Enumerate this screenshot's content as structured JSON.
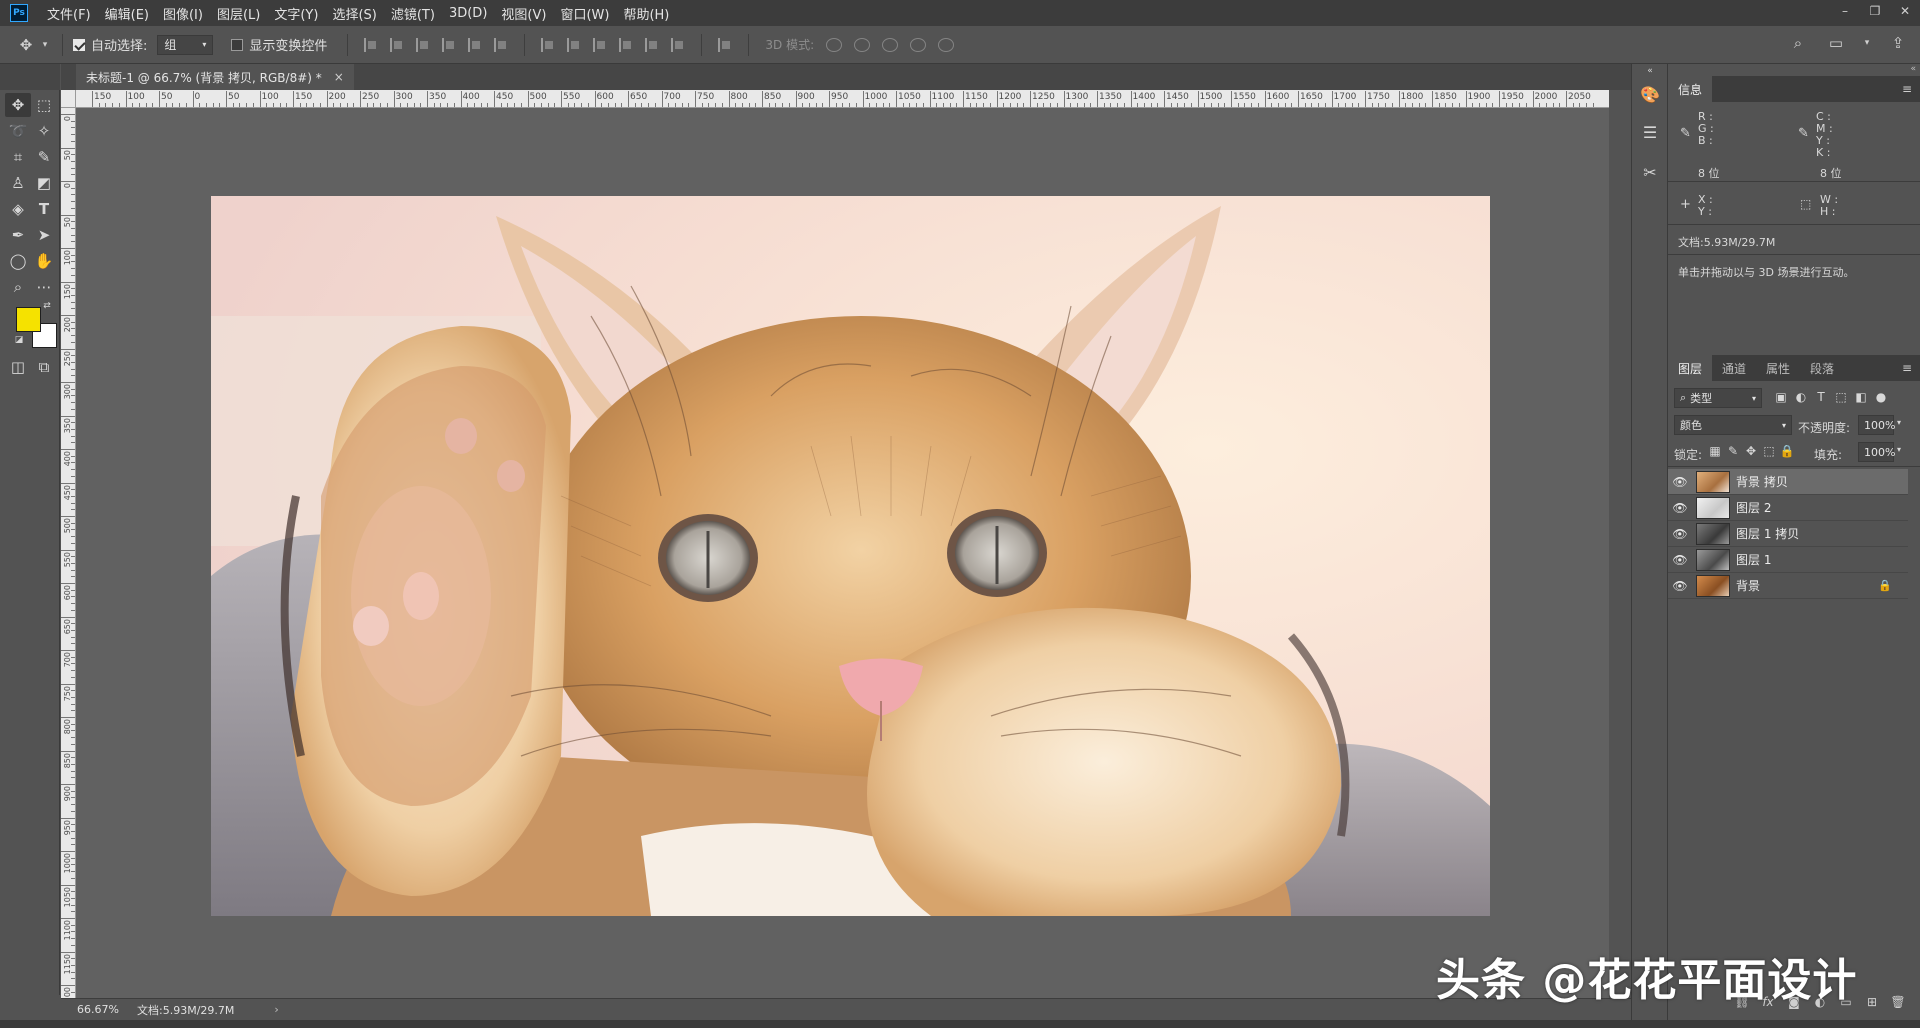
{
  "app": {
    "logo": "Ps"
  },
  "menu": [
    "文件(F)",
    "编辑(E)",
    "图像(I)",
    "图层(L)",
    "文字(Y)",
    "选择(S)",
    "滤镜(T)",
    "3D(D)",
    "视图(V)",
    "窗口(W)",
    "帮助(H)"
  ],
  "options": {
    "auto_select_label": "自动选择:",
    "auto_select_checked": true,
    "auto_select_value": "组",
    "show_transform_label": "显示变换控件",
    "show_transform_checked": false,
    "mode_3d_label": "3D 模式:"
  },
  "document": {
    "tab_title": "未标题-1 @ 66.7% (背景 拷贝, RGB/8#) *",
    "close": "×",
    "zoom": "66.67%",
    "doc_size": "文档:5.93M/29.7M"
  },
  "rulers": {
    "top_labels": [
      "150",
      "100",
      "50",
      "0",
      "50",
      "100",
      "150",
      "200",
      "250",
      "300",
      "350",
      "400",
      "450",
      "500",
      "550",
      "600",
      "650",
      "700",
      "750",
      "800",
      "850",
      "900",
      "950",
      "1000",
      "1050",
      "1100",
      "1150",
      "1200",
      "1250",
      "1300",
      "1350",
      "1400",
      "1450",
      "1500",
      "1550",
      "1600",
      "1650",
      "1700",
      "1750",
      "1800",
      "1850",
      "1900",
      "1950",
      "2000",
      "2050"
    ],
    "left_labels": [
      "0",
      "50",
      "0",
      "50",
      "100",
      "150",
      "200",
      "250",
      "300",
      "350",
      "400",
      "450",
      "500",
      "550",
      "600",
      "650",
      "700",
      "750",
      "800",
      "850",
      "900",
      "950",
      "1000",
      "1050",
      "1100",
      "1150",
      "1200"
    ]
  },
  "colors": {
    "foreground": "#f5e200",
    "background": "#ffffff",
    "accent": "#31a8ff"
  },
  "info_panel": {
    "tab": "信息",
    "rgb_labels": [
      "R :",
      "G :",
      "B :"
    ],
    "cmyk_labels": [
      "C :",
      "M :",
      "Y :",
      "K :"
    ],
    "bit_left": "8 位",
    "bit_right": "8 位",
    "xy_labels": [
      "X :",
      "Y :"
    ],
    "wh_labels": [
      "W :",
      "H :"
    ],
    "doc": "文档:5.93M/29.7M",
    "hint": "单击并拖动以与 3D 场景进行互动。"
  },
  "layers_panel": {
    "tabs": [
      "图层",
      "通道",
      "属性",
      "段落"
    ],
    "filter": "类型",
    "blend_mode": "颜色",
    "opacity_label": "不透明度:",
    "opacity": "100%",
    "lock_label": "锁定:",
    "fill_label": "填充:",
    "fill": "100%",
    "layers": [
      {
        "name": "背景 拷贝",
        "selected": true,
        "locked": false
      },
      {
        "name": "图层 2",
        "selected": false,
        "locked": false
      },
      {
        "name": "图层 1 拷贝",
        "selected": false,
        "locked": false
      },
      {
        "name": "图层 1",
        "selected": false,
        "locked": false
      },
      {
        "name": "背景",
        "selected": false,
        "locked": true
      }
    ]
  },
  "watermark": "头条 @花花平面设计"
}
